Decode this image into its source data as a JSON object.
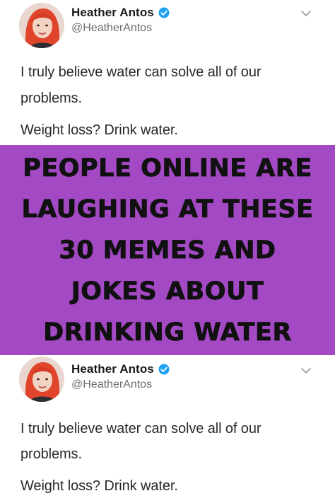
{
  "tweet": {
    "display_name": "Heather Antos",
    "handle": "@HeatherAntos",
    "lines": [
      "I truly believe water can solve all of our",
      "problems.",
      "Weight loss? Drink water."
    ],
    "icons": {
      "verified": "verified-badge-icon",
      "menu": "chevron-down-icon",
      "avatar": "profile-avatar"
    },
    "accent_color": "#1da1f2"
  },
  "banner": {
    "background": "#a349c4",
    "lines": [
      "PEOPLE ONLINE ARE",
      "LAUGHING AT THESE",
      "30 MEMES AND",
      "JOKES ABOUT",
      "DRINKING WATER"
    ]
  }
}
